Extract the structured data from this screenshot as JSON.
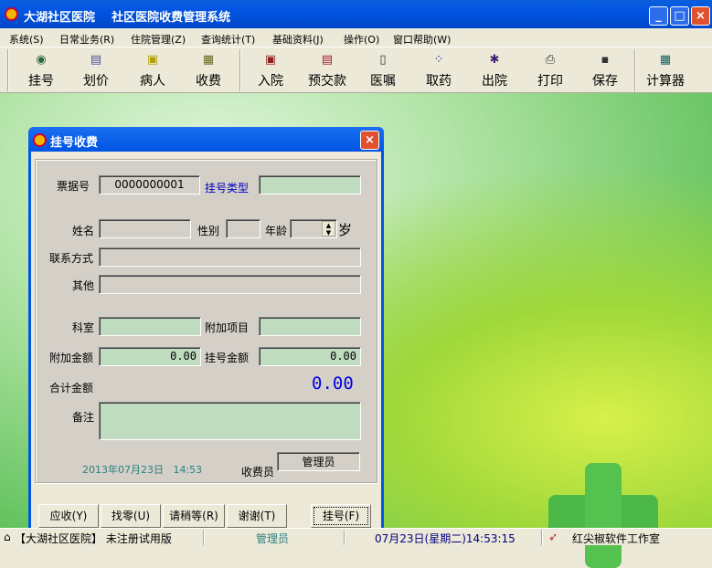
{
  "window": {
    "title": "大湖社区医院    社区医院收费管理系统",
    "minimize": "_",
    "maximize": "□",
    "close": "×"
  },
  "menu": [
    "系统(S)",
    "日常业务(R)",
    "住院管理(Z)",
    "查询统计(T)",
    "基础资料(J)",
    "操作(O)",
    "窗口帮助(W)"
  ],
  "toolbar": [
    {
      "label": "挂号",
      "icon": "register-icon",
      "glyph": "◉",
      "color": "#2a6a3a"
    },
    {
      "label": "划价",
      "icon": "pricing-icon",
      "glyph": "▤",
      "color": "#5050a0"
    },
    {
      "label": "病人",
      "icon": "patient-icon",
      "glyph": "▣",
      "color": "#b0a000"
    },
    {
      "label": "收费",
      "icon": "charge-icon",
      "glyph": "▦",
      "color": "#6a6a20"
    },
    {
      "label": "入院",
      "icon": "admission-icon",
      "glyph": "▣",
      "color": "#902020"
    },
    {
      "label": "预交款",
      "icon": "prepay-icon",
      "glyph": "▤",
      "color": "#a02030"
    },
    {
      "label": "医嘱",
      "icon": "doctor-order-icon",
      "glyph": "▯",
      "color": "#333"
    },
    {
      "label": "取药",
      "icon": "medicine-icon",
      "glyph": "⁘",
      "color": "#202090"
    },
    {
      "label": "出院",
      "icon": "discharge-icon",
      "glyph": "✱",
      "color": "#402070"
    },
    {
      "label": "打印",
      "icon": "printer-icon",
      "glyph": "⎙",
      "color": "#333"
    },
    {
      "label": "保存",
      "icon": "save-icon",
      "glyph": "▪",
      "color": "#333"
    },
    {
      "label": "计算器",
      "icon": "calculator-icon",
      "glyph": "▦",
      "color": "#106060"
    }
  ],
  "dialog": {
    "title": "挂号收费",
    "ticket_label": "票据号",
    "ticket_value": "0000000001",
    "type_label": "挂号类型",
    "type_value": "",
    "name_label": "姓名",
    "gender_label": "性别",
    "age_label": "年龄",
    "age_unit": "岁",
    "contact_label": "联系方式",
    "other_label": "其他",
    "dept_label": "科室",
    "extra_item_label": "附加项目",
    "extra_amount_label": "附加金额",
    "extra_amount": "0.00",
    "reg_amount_label": "挂号金额",
    "reg_amount": "0.00",
    "total_label": "合计金额",
    "total": "0.00",
    "note_label": "备注",
    "datetime": "2013年07月23日   14:53",
    "cashier_label": "收费员",
    "cashier": "管理员",
    "buttons": {
      "receivable": "应收(Y)",
      "change": "找零(U)",
      "wait": "请稍等(R)",
      "thanks": "谢谢(T)",
      "register": "挂号(F)"
    }
  },
  "status": {
    "hospital": "【大湖社区医院】 未注册试用版",
    "user": "管理员",
    "datetime": "07月23日(星期二)14:53:15",
    "vendor": "红尖椒软件工作室"
  }
}
